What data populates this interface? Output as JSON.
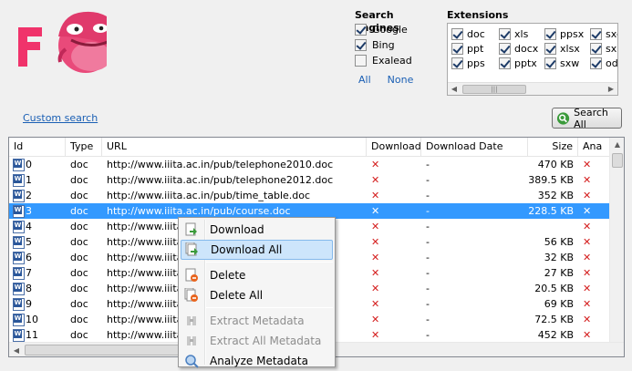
{
  "engines": {
    "title": "Search engines",
    "items": [
      {
        "label": "Google",
        "checked": true
      },
      {
        "label": "Bing",
        "checked": true
      },
      {
        "label": "Exalead",
        "checked": false
      }
    ],
    "all_label": "All",
    "none_label": "None"
  },
  "extensions": {
    "title": "Extensions",
    "items": [
      {
        "label": "doc",
        "checked": true
      },
      {
        "label": "xls",
        "checked": true
      },
      {
        "label": "ppsx",
        "checked": true
      },
      {
        "label": "sxc",
        "checked": true
      },
      {
        "label": "ppt",
        "checked": true
      },
      {
        "label": "docx",
        "checked": true
      },
      {
        "label": "xlsx",
        "checked": true
      },
      {
        "label": "sxi",
        "checked": true
      },
      {
        "label": "pps",
        "checked": true
      },
      {
        "label": "pptx",
        "checked": true
      },
      {
        "label": "sxw",
        "checked": true
      },
      {
        "label": "odt",
        "checked": true
      }
    ],
    "scroll_thumb_glyph": "|||"
  },
  "custom_search_label": "Custom search",
  "search_all_label": "Search All",
  "table": {
    "headers": {
      "id": "Id",
      "type": "Type",
      "url": "URL",
      "download": "Download",
      "download_date": "Download Date",
      "size": "Size",
      "analyzed": "Ana"
    },
    "rows": [
      {
        "id": "0",
        "type": "doc",
        "url": "http://www.iiita.ac.in/pub/telephone2010.doc",
        "download": "✕",
        "date": "-",
        "size": "470 KB",
        "an": "✕"
      },
      {
        "id": "1",
        "type": "doc",
        "url": "http://www.iiita.ac.in/pub/telephone2012.doc",
        "download": "✕",
        "date": "-",
        "size": "389.5 KB",
        "an": "✕"
      },
      {
        "id": "2",
        "type": "doc",
        "url": "http://www.iiita.ac.in/pub/time_table.doc",
        "download": "✕",
        "date": "-",
        "size": "352 KB",
        "an": "✕"
      },
      {
        "id": "3",
        "type": "doc",
        "url": "http://www.iiita.ac.in/pub/course.doc",
        "download": "✕",
        "date": "-",
        "size": "228.5 KB",
        "an": "✕",
        "selected": true
      },
      {
        "id": "4",
        "type": "doc",
        "url": "http://www.iiita.",
        "download": "✕",
        "date": "-",
        "size": "",
        "an": "✕"
      },
      {
        "id": "5",
        "type": "doc",
        "url": "http://www.iiita.",
        "download": "✕",
        "date": "-",
        "size": "56 KB",
        "an": "✕"
      },
      {
        "id": "6",
        "type": "doc",
        "url": "http://www.iiita.",
        "download": "✕",
        "date": "-",
        "size": "32 KB",
        "an": "✕"
      },
      {
        "id": "7",
        "type": "doc",
        "url": "http://www.iiita.",
        "download": "✕",
        "date": "-",
        "size": "27 KB",
        "an": "✕"
      },
      {
        "id": "8",
        "type": "doc",
        "url": "http://www.iiita.a                                T.d...",
        "download": "✕",
        "date": "-",
        "size": "20.5 KB",
        "an": "✕"
      },
      {
        "id": "9",
        "type": "doc",
        "url": "http://www.iiita.a",
        "download": "✕",
        "date": "-",
        "size": "69 KB",
        "an": "✕"
      },
      {
        "id": "10",
        "type": "doc",
        "url": "http://www.iiita.a                              atL...",
        "download": "✕",
        "date": "-",
        "size": "72.5 KB",
        "an": "✕"
      },
      {
        "id": "11",
        "type": "doc",
        "url": "http://www.iiita.a",
        "download": "✕",
        "date": "-",
        "size": "452 KB",
        "an": "✕"
      }
    ]
  },
  "context_menu": {
    "items": [
      {
        "label": "Download",
        "icon": "download-icon",
        "disabled": false
      },
      {
        "label": "Download All",
        "icon": "download-all-icon",
        "disabled": false,
        "hover": true
      },
      {
        "label": "Delete",
        "icon": "delete-icon",
        "disabled": false
      },
      {
        "label": "Delete All",
        "icon": "delete-all-icon",
        "disabled": false
      },
      {
        "label": "Extract Metadata",
        "icon": "extract-metadata-icon",
        "disabled": true
      },
      {
        "label": "Extract All Metadata",
        "icon": "extract-all-metadata-icon",
        "disabled": true
      },
      {
        "label": "Analyze Metadata",
        "icon": "analyze-metadata-icon",
        "disabled": false
      }
    ]
  },
  "colors": {
    "selection": "#3399ff",
    "x_mark": "#d41c1c",
    "logo_pink": "#f0336b",
    "link": "#1a5fb4"
  }
}
